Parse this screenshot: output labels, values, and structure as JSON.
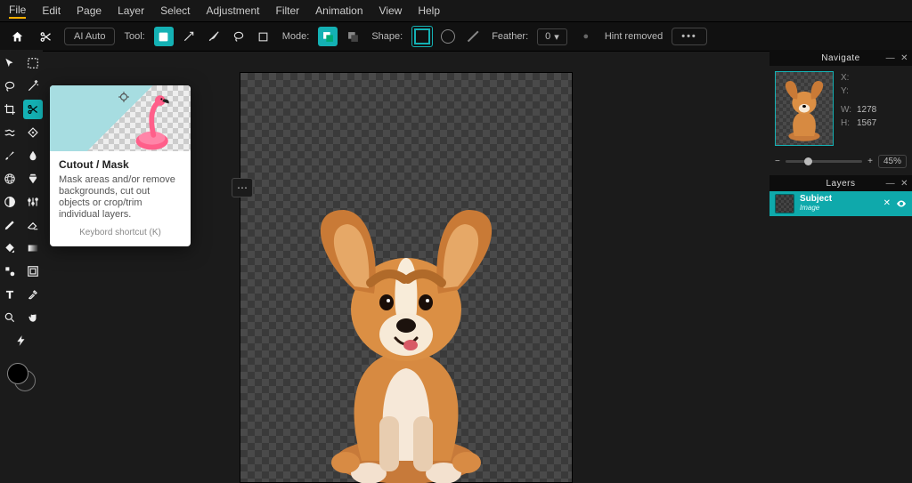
{
  "menubar": [
    "File",
    "Edit",
    "Page",
    "Layer",
    "Select",
    "Adjustment",
    "Filter",
    "Animation",
    "View",
    "Help"
  ],
  "options": {
    "ai_auto": "AI Auto",
    "tool_label": "Tool:",
    "mode_label": "Mode:",
    "shape_label": "Shape:",
    "feather_label": "Feather:",
    "feather_value": "0",
    "hint": "Hint removed"
  },
  "tooltip": {
    "title": "Cutout / Mask",
    "desc": "Mask areas and/or remove backgrounds, cut out objects or crop/trim individual layers.",
    "shortcut": "Keybord shortcut (K)"
  },
  "navigate": {
    "title": "Navigate",
    "x_label": "X:",
    "y_label": "Y:",
    "w_label": "W:",
    "h_label": "H:",
    "w_value": "1278",
    "h_value": "1567",
    "zoom": "45%"
  },
  "layers": {
    "title": "Layers",
    "item_name": "Subject",
    "item_type": "Image"
  }
}
